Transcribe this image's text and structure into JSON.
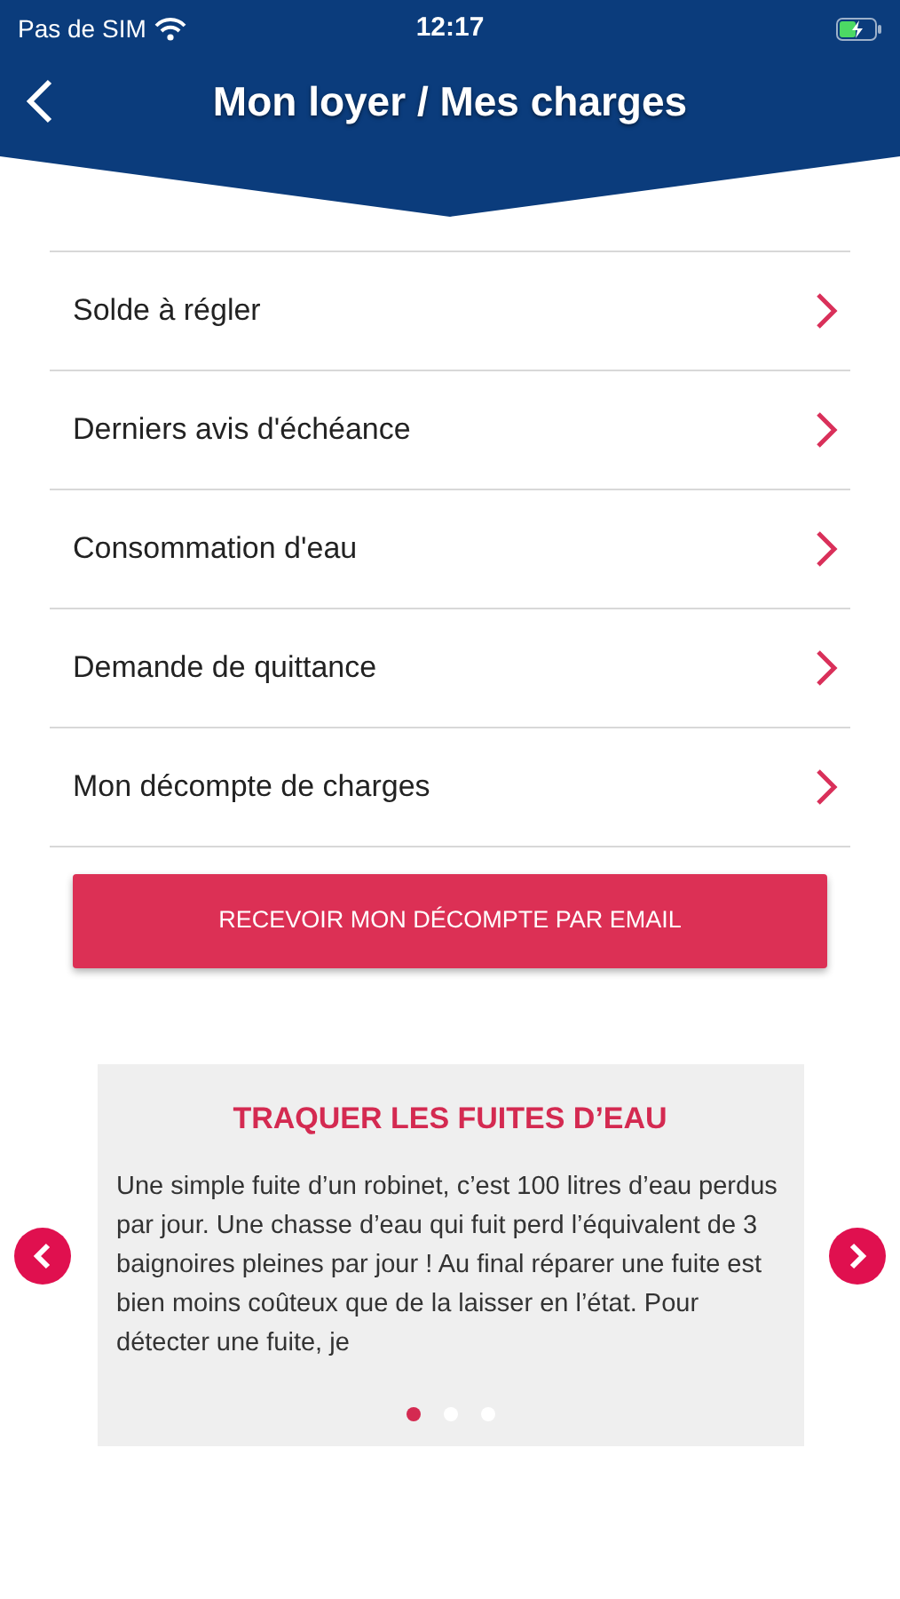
{
  "status_bar": {
    "carrier": "Pas de SIM",
    "time": "12:17"
  },
  "header": {
    "title": "Mon loyer / Mes charges"
  },
  "menu": [
    {
      "label": "Solde à régler"
    },
    {
      "label": "Derniers avis d'échéance"
    },
    {
      "label": "Consommation d'eau"
    },
    {
      "label": "Demande de quittance"
    },
    {
      "label": "Mon décompte de charges"
    }
  ],
  "email_button": "RECEVOIR MON DÉCOMPTE PAR EMAIL",
  "carousel": {
    "title": "TRAQUER LES FUITES D’EAU",
    "text": "Une simple fuite d’un robinet, c’est 100 litres d’eau perdus par jour. Une chasse d’eau qui fuit perd l’équivalent de 3 baignoires pleines par jour ! Au final réparer une fuite est bien moins coûteux que de la laisser en l’état. Pour détecter une fuite, je",
    "dots": [
      {
        "selected": true
      },
      {
        "selected": false
      },
      {
        "selected": false
      }
    ]
  }
}
